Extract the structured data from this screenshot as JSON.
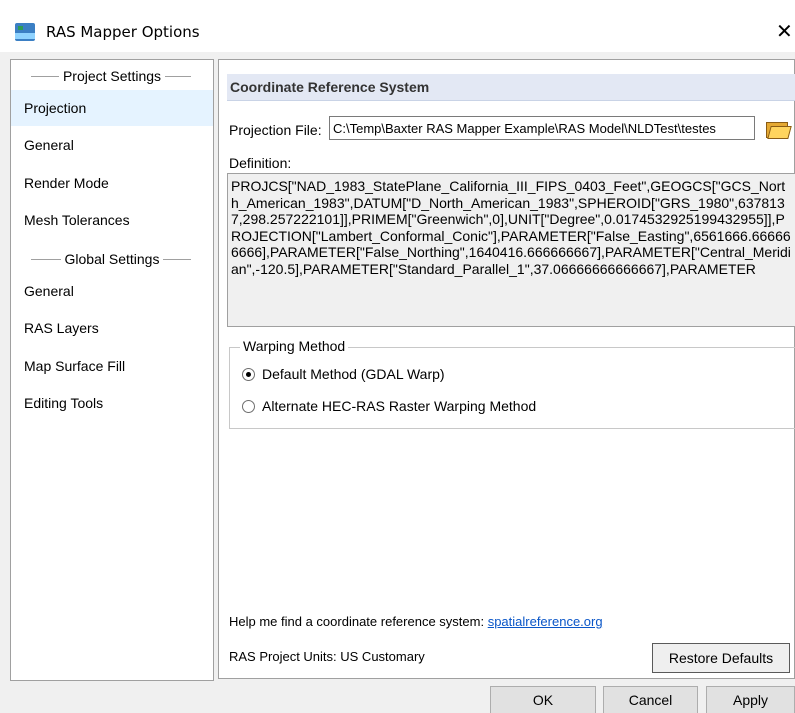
{
  "window": {
    "title": "RAS Mapper Options",
    "app_icon": "ras-mapper-app-icon",
    "close_glyph": "✕"
  },
  "sidebar": {
    "project_header": "Project Settings",
    "project_items": [
      {
        "label": "Projection",
        "selected": true
      },
      {
        "label": "General"
      },
      {
        "label": "Render Mode"
      },
      {
        "label": "Mesh Tolerances"
      }
    ],
    "global_header": "Global Settings",
    "global_items": [
      {
        "label": "General"
      },
      {
        "label": "RAS Layers"
      },
      {
        "label": "Map Surface Fill"
      },
      {
        "label": "Editing Tools"
      }
    ]
  },
  "content": {
    "section_title": "Coordinate Reference System",
    "projection_file_label": "Projection File:",
    "projection_file_value": "C:\\Temp\\Baxter RAS Mapper Example\\RAS Model\\NLDTest\\testes",
    "browse_icon": "folder-open-icon",
    "definition_label": "Definition:",
    "definition_text": "PROJCS[\"NAD_1983_StatePlane_California_III_FIPS_0403_Feet\",GEOGCS[\"GCS_North_American_1983\",DATUM[\"D_North_American_1983\",SPHEROID[\"GRS_1980\",6378137,298.257222101]],PRIMEM[\"Greenwich\",0],UNIT[\"Degree\",0.0174532925199432955]],PROJECTION[\"Lambert_Conformal_Conic\"],PARAMETER[\"False_Easting\",6561666.666666666],PARAMETER[\"False_Northing\",1640416.666666667],PARAMETER[\"Central_Meridian\",-120.5],PARAMETER[\"Standard_Parallel_1\",37.06666666666667],PARAMETER",
    "warping_group_label": "Warping Method",
    "warping_options": [
      {
        "label": "Default Method (GDAL Warp)",
        "checked": true
      },
      {
        "label": "Alternate HEC-RAS Raster Warping Method",
        "checked": false
      }
    ],
    "help_text": "Help me find a coordinate reference system: ",
    "help_link": "spatialreference.org",
    "units_text": "RAS Project Units: US Customary",
    "restore_button": "Restore Defaults"
  },
  "footer": {
    "ok": "OK",
    "cancel": "Cancel",
    "apply": "Apply"
  },
  "colors": {
    "selected_nav_bg": "#e5f3ff",
    "section_header_bg": "#e3e8f4",
    "link": "#0a56c8"
  }
}
